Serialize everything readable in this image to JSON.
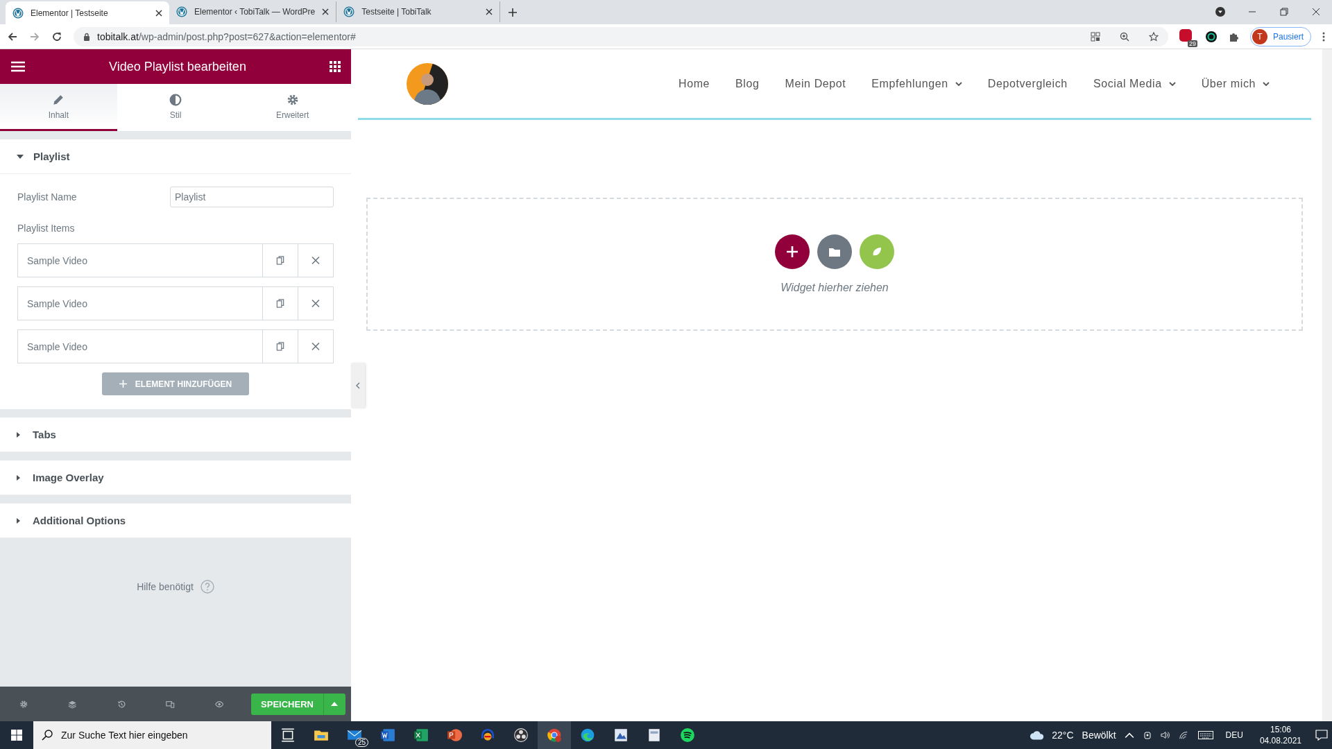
{
  "browser": {
    "tabs": [
      {
        "title": "Elementor | Testseite",
        "selected": true
      },
      {
        "title": "Elementor ‹ TobiTalk — WordPre",
        "selected": false
      },
      {
        "title": "Testseite | TobiTalk",
        "selected": false
      }
    ],
    "url_host": "tobitalk.at",
    "url_path": "/wp-admin/post.php?post=627&action=elementor#",
    "extension_badge": "29",
    "profile_initial": "T",
    "profile_status": "Pausiert"
  },
  "editor": {
    "title": "Video Playlist bearbeiten",
    "tabs": [
      {
        "label": "Inhalt",
        "kind": "pencil",
        "selected": true
      },
      {
        "label": "Stil",
        "kind": "contrast",
        "selected": false
      },
      {
        "label": "Erweitert",
        "kind": "gear",
        "selected": false
      }
    ],
    "playlist_section": {
      "title": "Playlist",
      "expanded": true
    },
    "playlist_name": {
      "label": "Playlist Name",
      "value": "Playlist"
    },
    "items_label": "Playlist Items",
    "items": [
      {
        "title": "Sample Video"
      },
      {
        "title": "Sample Video"
      },
      {
        "title": "Sample Video"
      }
    ],
    "add_button": "ELEMENT HINZUFÜGEN",
    "sections": [
      {
        "title": "Tabs",
        "expanded": false
      },
      {
        "title": "Image Overlay",
        "expanded": false
      },
      {
        "title": "Additional Options",
        "expanded": false
      }
    ],
    "help": "Hilfe benötigt",
    "save_button": "SPEICHERN"
  },
  "site": {
    "nav": [
      {
        "label": "Home",
        "dropdown": false
      },
      {
        "label": "Blog",
        "dropdown": false
      },
      {
        "label": "Mein Depot",
        "dropdown": false
      },
      {
        "label": "Empfehlungen",
        "dropdown": true
      },
      {
        "label": "Depotvergleich",
        "dropdown": false
      },
      {
        "label": "Social Media",
        "dropdown": true
      },
      {
        "label": "Über mich",
        "dropdown": true
      }
    ],
    "dropzone_text": "Widget hierher ziehen"
  },
  "taskbar": {
    "search_placeholder": "Zur Suche Text hier eingeben",
    "mail_badge": "25",
    "temperature": "22°C",
    "weather": "Bewölkt",
    "language": "DEU",
    "time": "15:06",
    "date": "04.08.2021"
  }
}
